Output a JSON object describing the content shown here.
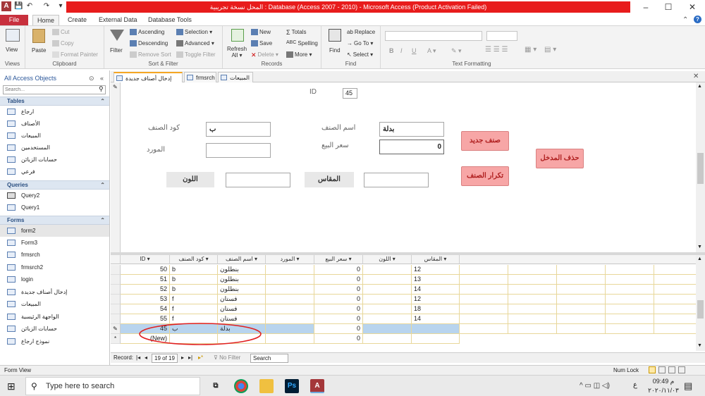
{
  "titlebar": {
    "title": "المحل نسخة تجريبية : Database (Access 2007 - 2010) - Microsoft Access (Product Activation Failed)",
    "app_icon": "A",
    "minimize": "–",
    "maximize": "☐",
    "close": "✕"
  },
  "ribbon_tabs": [
    "File",
    "Home",
    "Create",
    "External Data",
    "Database Tools"
  ],
  "ribbon": {
    "views": {
      "view_label": "View",
      "group": "Views"
    },
    "clipboard": {
      "paste": "Paste",
      "cut": "Cut",
      "copy": "Copy",
      "format_painter": "Format Painter",
      "group": "Clipboard"
    },
    "sort_filter": {
      "filter": "Filter",
      "ascending": "Ascending",
      "descending": "Descending",
      "remove_sort": "Remove Sort",
      "selection": "Selection",
      "advanced": "Advanced",
      "toggle_filter": "Toggle Filter",
      "group": "Sort & Filter"
    },
    "records": {
      "refresh": "Refresh",
      "refresh_all": "All",
      "new": "New",
      "save": "Save",
      "delete": "Delete",
      "totals": "Totals",
      "spelling": "Spelling",
      "more": "More",
      "group": "Records"
    },
    "find": {
      "find": "Find",
      "replace": "Replace",
      "goto": "Go To",
      "select": "Select",
      "group": "Find"
    },
    "text_formatting": {
      "group": "Text Formatting"
    }
  },
  "nav": {
    "title": "All Access Objects",
    "search_placeholder": "Search...",
    "tables_label": "Tables",
    "tables": [
      "ارجاع",
      "الأصناف",
      "المبيعات",
      "المستخدمين",
      "حسابات الزبائن",
      "فرعي"
    ],
    "queries_label": "Queries",
    "queries": [
      "Query2",
      "Query1"
    ],
    "forms_label": "Forms",
    "forms": [
      "form2",
      "Form3",
      "frmsrch",
      "frmsrch2",
      "login",
      "إدخال أصناف جديدة",
      "المبيعات",
      "الواجهة الرئيسية",
      "حسابات الزبائن",
      "نموذج ارجاع"
    ]
  },
  "doc_tabs": [
    "إدخال أصناف جديدة",
    "frmsrch",
    "المبيعات"
  ],
  "form": {
    "id_label": "ID",
    "id_value": "45",
    "code_label": "كود الصنف",
    "code_value": "ب",
    "name_label": "اسم الصنف",
    "name_value": "بدلة",
    "supplier_label": "المورد",
    "supplier_value": "",
    "price_label": "سعر البيع",
    "price_value": "0",
    "color_label": "اللون",
    "color_value": "",
    "size_label": "المقاس",
    "size_value": "",
    "btn_new_item": "صنف جديد",
    "btn_repeat_item": "تكرار الصنف",
    "btn_delete_entry": "حذف المدخل"
  },
  "datasheet": {
    "columns": [
      "ID",
      "كود الصنف",
      "اسم الصنف",
      "المورد",
      "سعر البيع",
      "اللون",
      "المقاس"
    ],
    "rows": [
      {
        "id": "50",
        "code": "b",
        "name": "بنطلون",
        "supplier": "",
        "price": "0",
        "color": "",
        "size": "12"
      },
      {
        "id": "51",
        "code": "b",
        "name": "بنطلون",
        "supplier": "",
        "price": "0",
        "color": "",
        "size": "13"
      },
      {
        "id": "52",
        "code": "b",
        "name": "بنطلون",
        "supplier": "",
        "price": "0",
        "color": "",
        "size": "14"
      },
      {
        "id": "53",
        "code": "f",
        "name": "فستان",
        "supplier": "",
        "price": "0",
        "color": "",
        "size": "12"
      },
      {
        "id": "54",
        "code": "f",
        "name": "فستان",
        "supplier": "",
        "price": "0",
        "color": "",
        "size": "18"
      },
      {
        "id": "55",
        "code": "f",
        "name": "فستان",
        "supplier": "",
        "price": "0",
        "color": "",
        "size": "14"
      },
      {
        "id": "45",
        "code": "ب",
        "name": "بدلة",
        "supplier": "",
        "price": "0",
        "color": "",
        "size": ""
      }
    ],
    "new_row_label": "(New)",
    "new_row_price": "0",
    "editing_marker": "✎",
    "new_marker": "*"
  },
  "record_bar": {
    "label": "Record:",
    "position": "19 of 19",
    "no_filter": "No Filter",
    "search": "Search"
  },
  "status": {
    "left": "Form View",
    "num_lock": "Num Lock"
  },
  "taskbar": {
    "search_placeholder": "Type here to search",
    "time": "09:49 م",
    "date": "٢٠٢٠/١١/٠٣",
    "lang": "ع"
  },
  "colors": {
    "accent_red": "#e81c1c",
    "file_tab": "#c8303d",
    "button_pink": "#f7a6a6",
    "selected_row": "#b8d4ee"
  }
}
